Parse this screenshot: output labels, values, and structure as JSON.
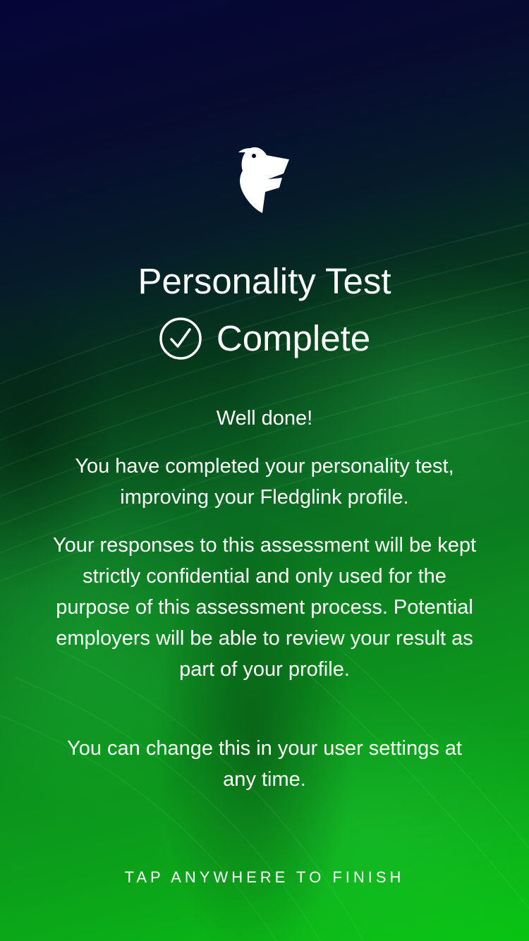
{
  "screen": {
    "title": "Personality Test",
    "status_label": "Complete",
    "status_icon": "check-circle-icon",
    "logo_icon": "fledglink-bird-logo",
    "paragraphs": [
      "Well done!",
      "You have completed your personality test, improving your Fledglink profile.",
      "Your responses to this assessment will be kept strictly confidential and only used for the purpose of this assessment process. Potential employers will be able to review your result as part of your profile.",
      "You can change this in your user settings at any time."
    ],
    "finish_label": "TAP ANYWHERE TO FINISH"
  },
  "colors": {
    "background_top": "#050638",
    "background_bottom": "#08c412",
    "text": "#ffffff"
  }
}
